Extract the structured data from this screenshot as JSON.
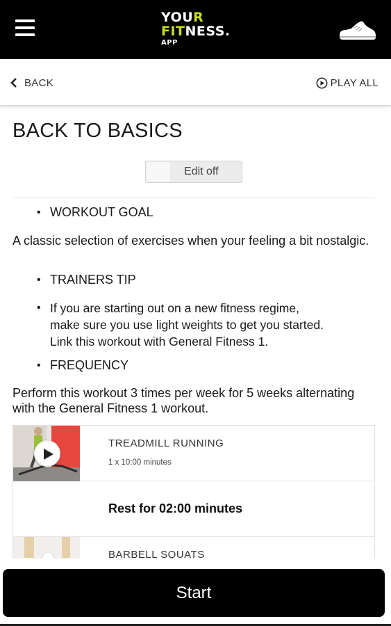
{
  "header": {
    "logo": {
      "line1_a": "YOU",
      "line1_b": "R",
      "line2_a": "FIT",
      "line2_b": "NESS.",
      "line3": "APP"
    },
    "accent_color": "#c8dc20",
    "menu_icon": "hamburger-menu-icon",
    "profile_icon": "sneaker-icon"
  },
  "nav": {
    "back_label": "BACK",
    "play_all_label": "PLAY ALL"
  },
  "workout": {
    "title": "BACK TO BASICS",
    "edit_toggle_label": "Edit off",
    "edit_toggle_on": false,
    "goal_heading": "WORKOUT GOAL",
    "goal_text": "A classic selection of exercises when your feeling a bit nostalgic.",
    "tip_heading": "TRAINERS TIP",
    "tip_line1": "If you are starting out on a new fitness regime,",
    "tip_line2": "make sure you use light weights to get you started.",
    "tip_line3": "Link this workout with General Fitness 1.",
    "frequency_heading": "FREQUENCY",
    "frequency_text": "Perform this workout 3 times per week for 5 weeks alternating with the General Fitness 1 workout."
  },
  "exercises": [
    {
      "name": "TREADMILL RUNNING",
      "sets": "1 x 10:00 minutes"
    },
    {
      "rest": "Rest for 02:00 minutes"
    },
    {
      "name": "BARBELL SQUATS"
    }
  ],
  "start_label": "Start"
}
